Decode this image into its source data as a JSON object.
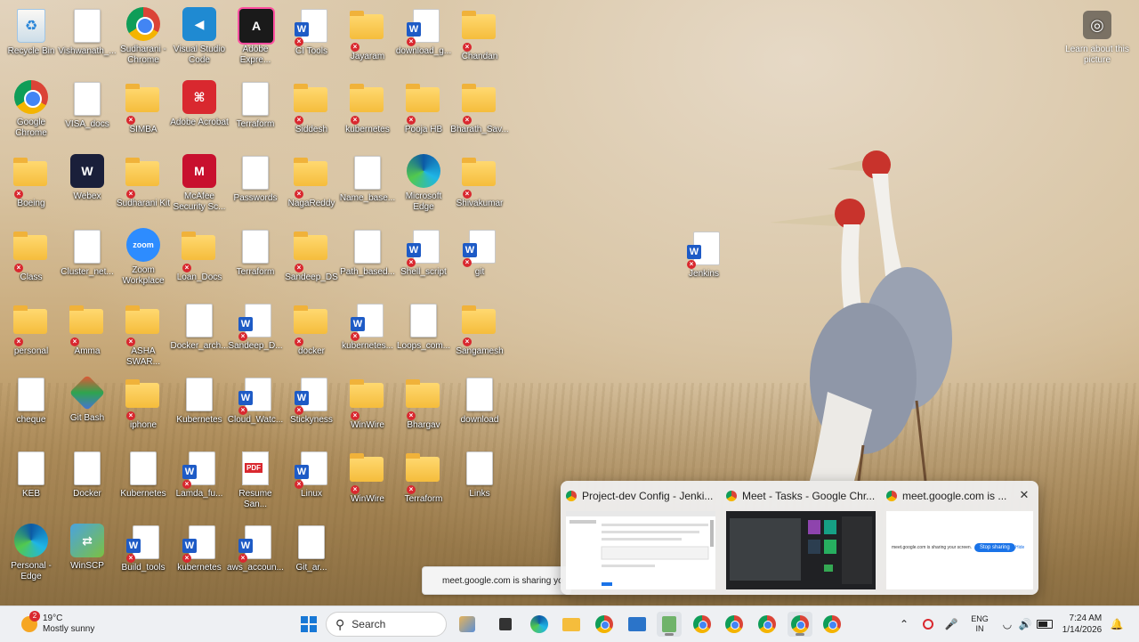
{
  "desktop": {
    "icons": [
      {
        "label": "Recycle Bin",
        "kind": "recycle"
      },
      {
        "label": "Vishwanath_...",
        "kind": "doc"
      },
      {
        "label": "Sudharani - Chrome",
        "kind": "chrome"
      },
      {
        "label": "Visual Studio Code",
        "kind": "vscode"
      },
      {
        "label": "Adobe Expre...",
        "kind": "adobe-express"
      },
      {
        "label": "CI Tools",
        "kind": "word"
      },
      {
        "label": "Jayaram",
        "kind": "folder"
      },
      {
        "label": "download_g...",
        "kind": "word"
      },
      {
        "label": "Chandan",
        "kind": "folder"
      },
      {
        "label": "Google Chrome",
        "kind": "chrome"
      },
      {
        "label": "VISA_docs",
        "kind": "doc"
      },
      {
        "label": "SIMBA",
        "kind": "folder"
      },
      {
        "label": "Adobe Acrobat",
        "kind": "acrobat"
      },
      {
        "label": "Terraform",
        "kind": "doc"
      },
      {
        "label": "Siddesh",
        "kind": "folder"
      },
      {
        "label": "kubernetes",
        "kind": "folder"
      },
      {
        "label": "Pooja HB",
        "kind": "folder"
      },
      {
        "label": "Bharath_Sav...",
        "kind": "folder"
      },
      {
        "label": "Boeing",
        "kind": "folder"
      },
      {
        "label": "Webex",
        "kind": "webex"
      },
      {
        "label": "Sudharani Kit",
        "kind": "folder"
      },
      {
        "label": "McAfee Security Sc...",
        "kind": "mcafee"
      },
      {
        "label": "Passwords",
        "kind": "doc"
      },
      {
        "label": "NagaReddy",
        "kind": "folder"
      },
      {
        "label": "Name_base...",
        "kind": "doc"
      },
      {
        "label": "Microsoft Edge",
        "kind": "edge"
      },
      {
        "label": "Shivakumar",
        "kind": "folder"
      },
      {
        "label": "Class",
        "kind": "folder"
      },
      {
        "label": "Cluster_net...",
        "kind": "doc"
      },
      {
        "label": "Zoom Workplace",
        "kind": "zoom"
      },
      {
        "label": "Loan_Docs",
        "kind": "folder"
      },
      {
        "label": "Terraform",
        "kind": "doc"
      },
      {
        "label": "Sandeep_DS",
        "kind": "folder"
      },
      {
        "label": "Path_based...",
        "kind": "doc"
      },
      {
        "label": "Shell_script",
        "kind": "word"
      },
      {
        "label": "git",
        "kind": "word"
      },
      {
        "label": "personal",
        "kind": "folder"
      },
      {
        "label": "Amma",
        "kind": "folder"
      },
      {
        "label": "ASHA SWAR...",
        "kind": "folder"
      },
      {
        "label": "Docker_arch...",
        "kind": "doc"
      },
      {
        "label": "Sandeep_D...",
        "kind": "word"
      },
      {
        "label": "docker",
        "kind": "folder"
      },
      {
        "label": "kubernetes...",
        "kind": "word"
      },
      {
        "label": "Loops_com...",
        "kind": "doc"
      },
      {
        "label": "Sangamesh",
        "kind": "folder"
      },
      {
        "label": "cheque",
        "kind": "pdfdoc"
      },
      {
        "label": "Git Bash",
        "kind": "gitbash"
      },
      {
        "label": "iphone",
        "kind": "folder"
      },
      {
        "label": "Kubernetes",
        "kind": "doc"
      },
      {
        "label": "Cloud_Watc...",
        "kind": "word"
      },
      {
        "label": "Stickyness",
        "kind": "word"
      },
      {
        "label": "WinWire",
        "kind": "folder"
      },
      {
        "label": "Bhargav",
        "kind": "folder"
      },
      {
        "label": "download",
        "kind": "doc"
      },
      {
        "label": "KEB",
        "kind": "pdfdoc"
      },
      {
        "label": "Docker",
        "kind": "doc"
      },
      {
        "label": "Kubernetes",
        "kind": "doc"
      },
      {
        "label": "Lamda_fu...",
        "kind": "word"
      },
      {
        "label": "Resume San...",
        "kind": "pdf"
      },
      {
        "label": "Linux",
        "kind": "word"
      },
      {
        "label": "WinWire",
        "kind": "folder"
      },
      {
        "label": "Terraform",
        "kind": "folder"
      },
      {
        "label": "Links",
        "kind": "doc"
      },
      {
        "label": "Personal - Edge",
        "kind": "edge"
      },
      {
        "label": "WinSCP",
        "kind": "winscp"
      },
      {
        "label": "Build_tools",
        "kind": "word"
      },
      {
        "label": "kubernetes",
        "kind": "word"
      },
      {
        "label": "aws_accoun...",
        "kind": "word"
      },
      {
        "label": "Git_ar...",
        "kind": "doc"
      },
      {
        "label": "Jenkins",
        "kind": "word"
      }
    ],
    "learn_label": "Learn about this picture"
  },
  "notification": {
    "text": "meet.google.com is sharing yo"
  },
  "thumbnails": [
    {
      "title": "Project-dev Config - Jenki..."
    },
    {
      "title": "Meet - Tasks - Google Chr..."
    },
    {
      "title": "meet.google.com is ..."
    }
  ],
  "thumb_content": {
    "share_text": "meet.google.com is sharing your screen.",
    "stop_label": "Stop sharing",
    "hide_label": "Hide"
  },
  "taskbar": {
    "weather_temp": "19°C",
    "weather_desc": "Mostly sunny",
    "weather_badge": "2",
    "search_label": "Search",
    "lang_top": "ENG",
    "lang_bottom": "IN",
    "time": "7:24 AM",
    "date": "1/14/2026"
  }
}
